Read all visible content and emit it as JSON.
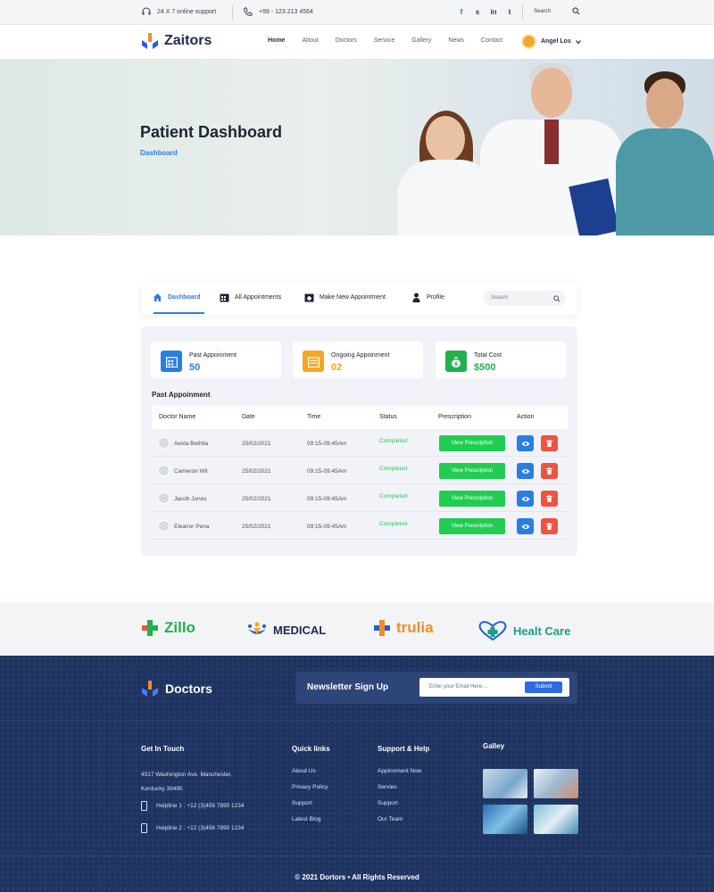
{
  "topbar": {
    "support": "24 X 7 online support",
    "phone": "+99 - 123 213 4564",
    "social": [
      "facebook-icon",
      "skype-icon",
      "linkedin-icon",
      "twitter-icon"
    ],
    "search_label": "Search"
  },
  "nav": {
    "brand": "Zaitors",
    "menu": [
      "Home",
      "About",
      "Doctors",
      "Service",
      "Gallery",
      "News",
      "Contact"
    ],
    "active": "Home",
    "user": "Angel Los"
  },
  "hero": {
    "title": "Patient Dashboard",
    "breadcrumb": "Dashboard"
  },
  "tabs": {
    "items": [
      "Dashboard",
      "All Appointments",
      "Make New Appointment",
      "Profile"
    ],
    "active": "Dashboard",
    "search_placeholder": "Search"
  },
  "stats": [
    {
      "label": "Past Appoinment",
      "value": "50",
      "color": "#2a7de1"
    },
    {
      "label": "Ongoing Appoinment",
      "value": "02",
      "color": "#f5a623"
    },
    {
      "label": "Total Cost",
      "value": "$500",
      "color": "#21b14f"
    }
  ],
  "table": {
    "title": "Past Appoinment",
    "headers": [
      "Doctor Name",
      "Date",
      "Time",
      "Status",
      "Prescription",
      "Action"
    ],
    "rows": [
      {
        "name": "Aexla Bethila",
        "date": "25/02/2021",
        "time": "09:15-09:45Am",
        "status": "Completed",
        "button": "View Prescription"
      },
      {
        "name": "Cameron Wil",
        "date": "25/02/2021",
        "time": "09:15-09:45Am",
        "status": "Completed",
        "button": "View Prescription"
      },
      {
        "name": "Jacob Jones",
        "date": "25/02/2021",
        "time": "09:15-09:45Am",
        "status": "Completed",
        "button": "View Prescription"
      },
      {
        "name": "Eleanor Pena",
        "date": "25/02/2021",
        "time": "09:15-09:45Am",
        "status": "Completed",
        "button": "View Prescription"
      }
    ]
  },
  "partners": [
    "Zillo",
    "MEDICAL",
    "trulia",
    "Healt Care"
  ],
  "footer": {
    "brand": "Doctors",
    "newsletter": {
      "title": "Newsletter Sign Up",
      "placeholder": "Enter your Email Here....",
      "button": "Submit"
    },
    "contact": {
      "title": "Get In  Touch",
      "address_line1": "4517 Washington Ave. Manchester,",
      "address_line2": "Kentucky 39495",
      "helpline1": "Helpline 1 :  +12 (3)456 7890 1234",
      "helpline2": "Helpline 2 :  +12 (3)456 7890 1234"
    },
    "quick_links": {
      "title": "Quick links",
      "items": [
        "About Us",
        "Privacy Policy",
        "Support",
        "Latest Blog"
      ]
    },
    "support": {
      "title": "Support & Help",
      "items": [
        "Appinnment Now",
        "Servies",
        "Support",
        "Our Team"
      ]
    },
    "gallery_title": "Galley",
    "copyright": "© 2021 Dortors  •  All Rights Reserved"
  }
}
